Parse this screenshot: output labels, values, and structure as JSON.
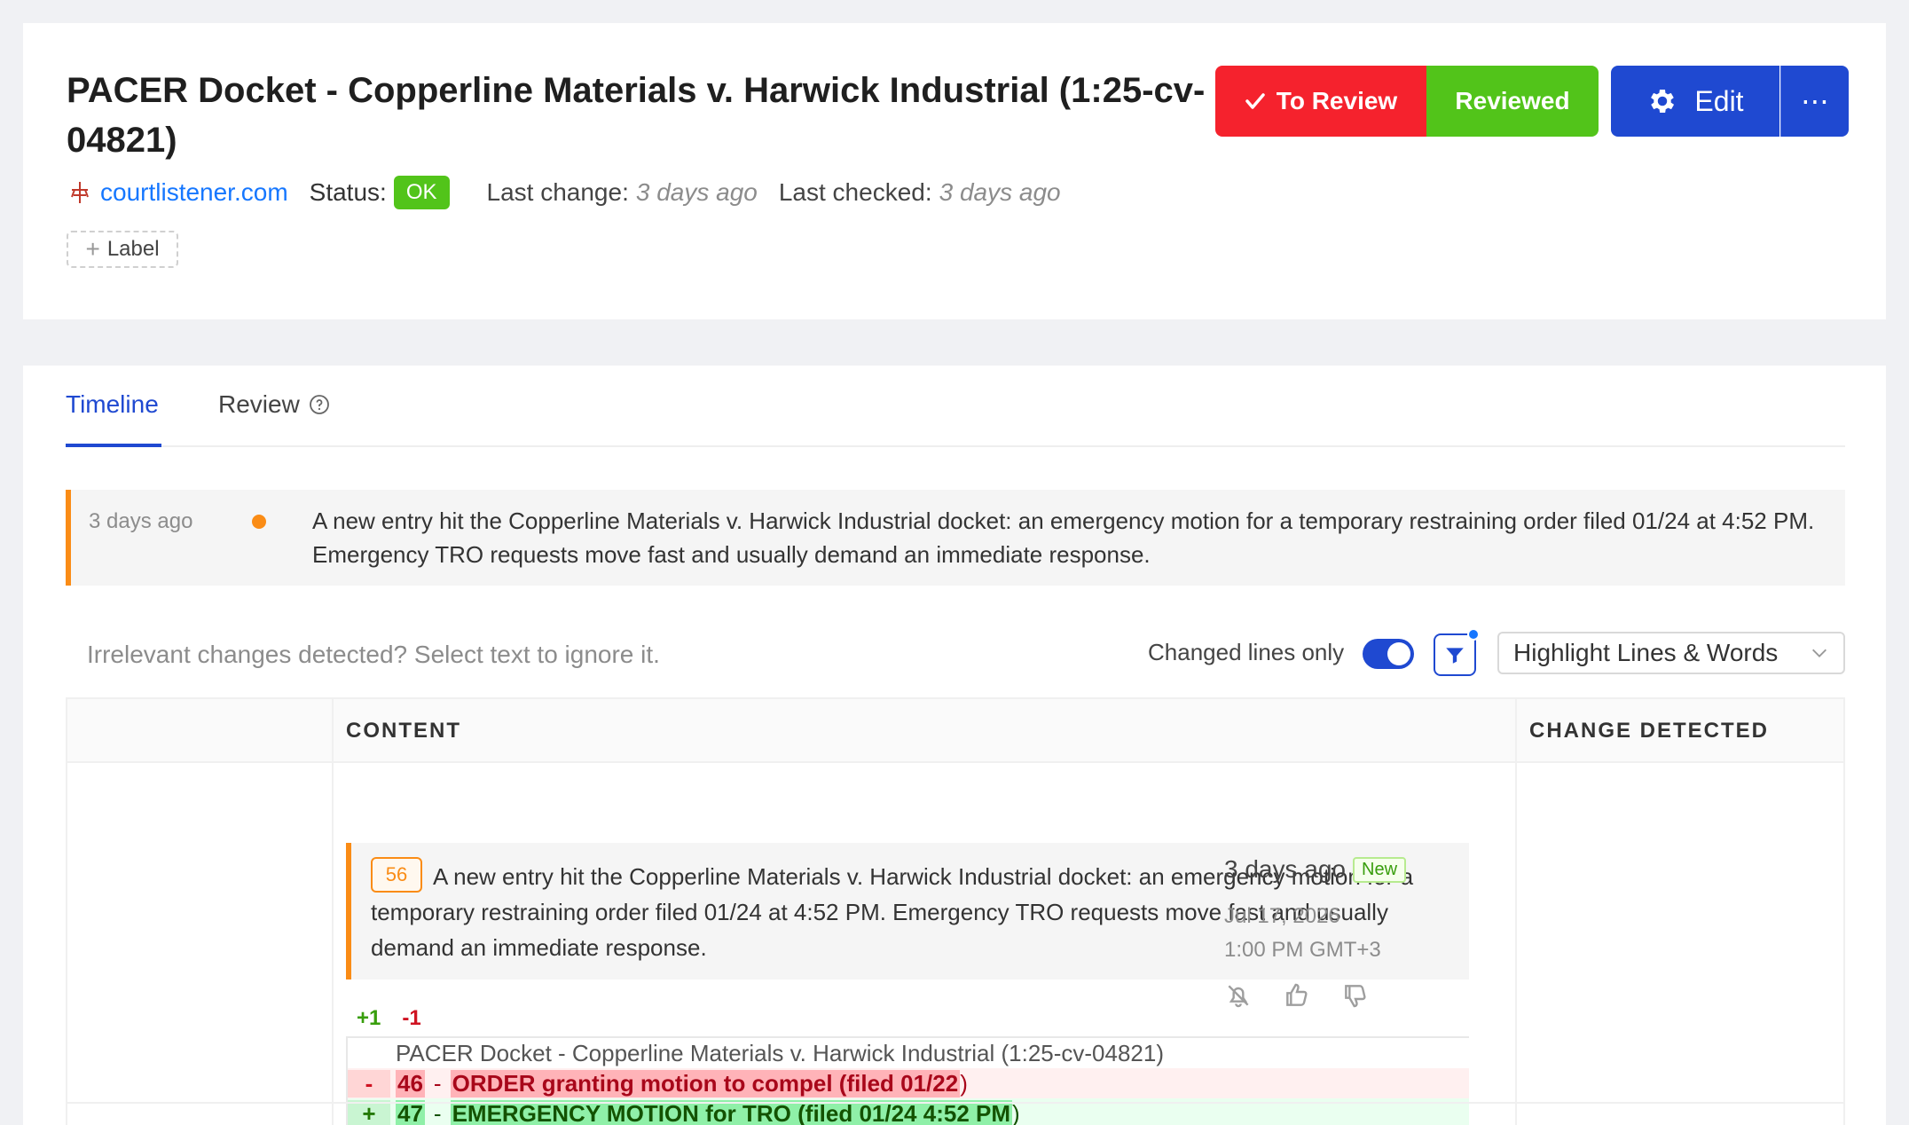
{
  "header": {
    "title": "PACER Docket - Copperline Materials v. Harwick Industrial (1:25-cv-04821)",
    "source": "courtlistener.com",
    "status_label": "Status:",
    "status_value": "OK",
    "last_change_label": "Last change:",
    "last_change_value": "3 days ago",
    "last_checked_label": "Last checked:",
    "last_checked_value": "3 days ago",
    "add_label": "Label"
  },
  "actions": {
    "to_review": "To Review",
    "reviewed": "Reviewed",
    "edit": "Edit",
    "more": "⋯"
  },
  "tabs": {
    "timeline": "Timeline",
    "review": "Review"
  },
  "timeline": {
    "time": "3 days ago",
    "text": "A new entry hit the Copperline Materials v. Harwick Industrial docket: an emergency motion for a temporary restraining order filed 01/24 at 4:52 PM. Emergency TRO requests move fast and usually demand an immediate response."
  },
  "toolbar": {
    "ignore_hint": "Irrelevant changes detected? Select text to ignore it.",
    "changed_only": "Changed lines only",
    "highlight_mode": "Highlight Lines & Words"
  },
  "table": {
    "col_content": "CONTENT",
    "col_change": "CHANGE DETECTED",
    "row": {
      "line_number": "56",
      "summary": "A new entry hit the Copperline Materials v. Harwick Industrial docket: an emergency motion for a temporary restraining order filed 01/24 at 4:52 PM. Emergency TRO requests move fast and usually demand an immediate response.",
      "added_count": "+1",
      "removed_count": "-1",
      "diff_context": "PACER Docket - Copperline Materials v. Harwick Industrial (1:25-cv-04821)",
      "diff_removed_num": "46",
      "diff_removed_text": "ORDER granting motion to compel (filed 01/22",
      "diff_added_num": "47",
      "diff_added_text": "EMERGENCY MOTION for TRO (filed 01/24 4:52 PM",
      "change_time": "3 days ago",
      "new_badge": "New",
      "change_date": "Jul 17, 2026",
      "change_clock": "1:00 PM GMT+3"
    }
  },
  "colors": {
    "accent": "#1f49d1",
    "danger": "#f5222d",
    "success": "#52c41a",
    "warning": "#fa8c16"
  },
  "icons": [
    "source-icon",
    "check-icon",
    "gear-icon",
    "help-icon",
    "filter-icon",
    "chevron-down-icon",
    "mute-icon",
    "thumbs-up-icon",
    "thumbs-down-icon"
  ]
}
